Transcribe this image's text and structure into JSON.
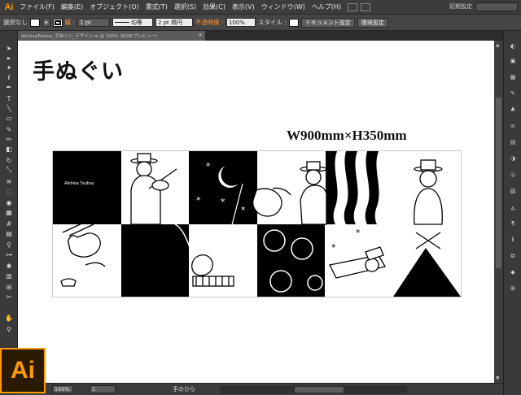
{
  "app": {
    "logo": "Ai",
    "workspace": "初期設定"
  },
  "menu": [
    "ファイル(F)",
    "編集(E)",
    "オブジェクト(O)",
    "書式(T)",
    "選択(S)",
    "効果(C)",
    "表示(V)",
    "ウィンドウ(W)",
    "ヘルプ(H)"
  ],
  "control": {
    "selection": "選択なし",
    "stroke_label": "線 :",
    "stroke_weight": "1 pt",
    "profile": "均等",
    "brush": "2 pt 楕円",
    "opacity_label": "不透明度 :",
    "opacity": "100%",
    "style_label": "スタイル :",
    "doc_settings": "ドキュメント設定",
    "preferences": "環境設定"
  },
  "document": {
    "tab": "AkihisaTsuboy_手ぬぐい_デザイン.ai @ 100% (RGB/プレビュー)",
    "close": "×",
    "title": "手ぬぐい",
    "dimension": "W900mm×H350mm",
    "artist_signature": "Akihisa Tsuboy"
  },
  "status": {
    "zoom": "100%",
    "page": "1",
    "tool_name": "手のひら"
  },
  "colors": {
    "accent": "#ff9a00",
    "chrome": "#3c3c3c",
    "canvas": "#ffffff"
  },
  "icons": [
    "selection-tool-icon",
    "direct-selection-icon",
    "magic-wand-icon",
    "lasso-icon",
    "pen-icon",
    "type-icon",
    "line-icon",
    "rectangle-icon",
    "paintbrush-icon",
    "pencil-icon",
    "eraser-icon",
    "rotate-icon",
    "scale-icon",
    "warp-icon",
    "free-transform-icon",
    "shape-builder-icon",
    "perspective-icon",
    "mesh-icon",
    "gradient-icon",
    "eyedropper-icon",
    "blend-icon",
    "symbol-sprayer-icon",
    "graph-icon",
    "artboard-icon",
    "slice-icon",
    "hand-icon",
    "zoom-icon"
  ]
}
